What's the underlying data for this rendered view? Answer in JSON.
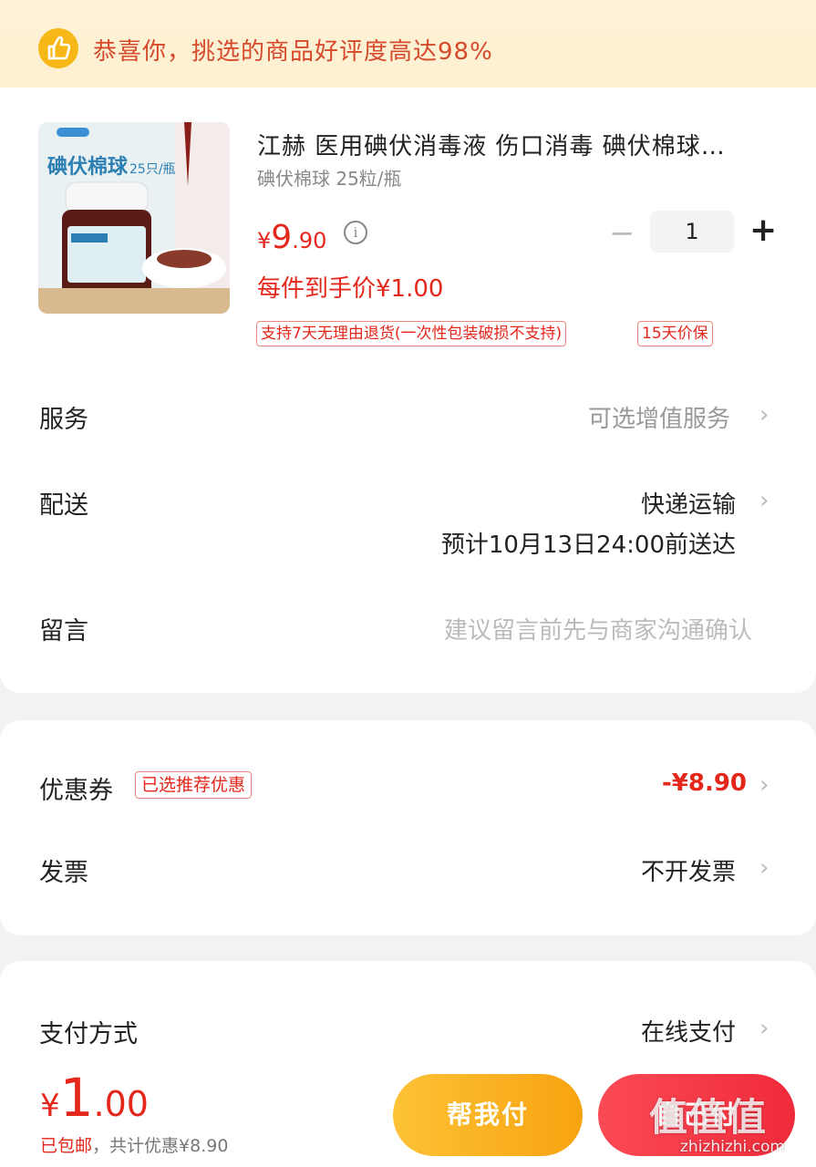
{
  "banner": {
    "text": "恭喜你，挑选的商品好评度高达98%",
    "icon": "thumbs-up-icon",
    "icon_color": "#f7b817"
  },
  "product": {
    "image_label": "碘伏棉球",
    "image_sublabel": "25只/瓶",
    "title": "江赫 医用碘伏消毒液 伤口消毒 碘伏棉球…",
    "spec": "碘伏棉球 25粒/瓶",
    "price_symbol": "¥",
    "price_int": "9",
    "price_dec": ".90",
    "quantity": "1",
    "minus_label": "−",
    "plus_label": "+",
    "each_price": "每件到手价¥1.00",
    "tags": [
      "支持7天无理由退货(一次性包装破损不支持)",
      "15天价保"
    ]
  },
  "rows": {
    "service": {
      "label": "服务",
      "value": "可选增值服务"
    },
    "delivery": {
      "label": "配送",
      "value": "快递运输",
      "eta": "预计10月13日24:00前送达"
    },
    "message": {
      "label": "留言",
      "placeholder": "建议留言前先与商家沟通确认"
    },
    "coupon": {
      "label": "优惠券",
      "badge": "已选推荐优惠",
      "value": "-¥8.90"
    },
    "invoice": {
      "label": "发票",
      "value": "不开发票"
    },
    "payment": {
      "label": "支付方式",
      "value": "在线支付"
    }
  },
  "bottom": {
    "total_symbol": "¥",
    "total_int": "1",
    "total_dec": ".00",
    "ship_note": "已包邮",
    "discount_note": "，共计优惠¥8.90",
    "help_pay": "帮我付",
    "self_pay": "自己付"
  },
  "watermark": {
    "glyphs": "值值值",
    "url": "zhizhizhi.com"
  },
  "colors": {
    "accent": "#e5261b",
    "help_button": "#f9b21f",
    "pay_button": "#f53545"
  }
}
